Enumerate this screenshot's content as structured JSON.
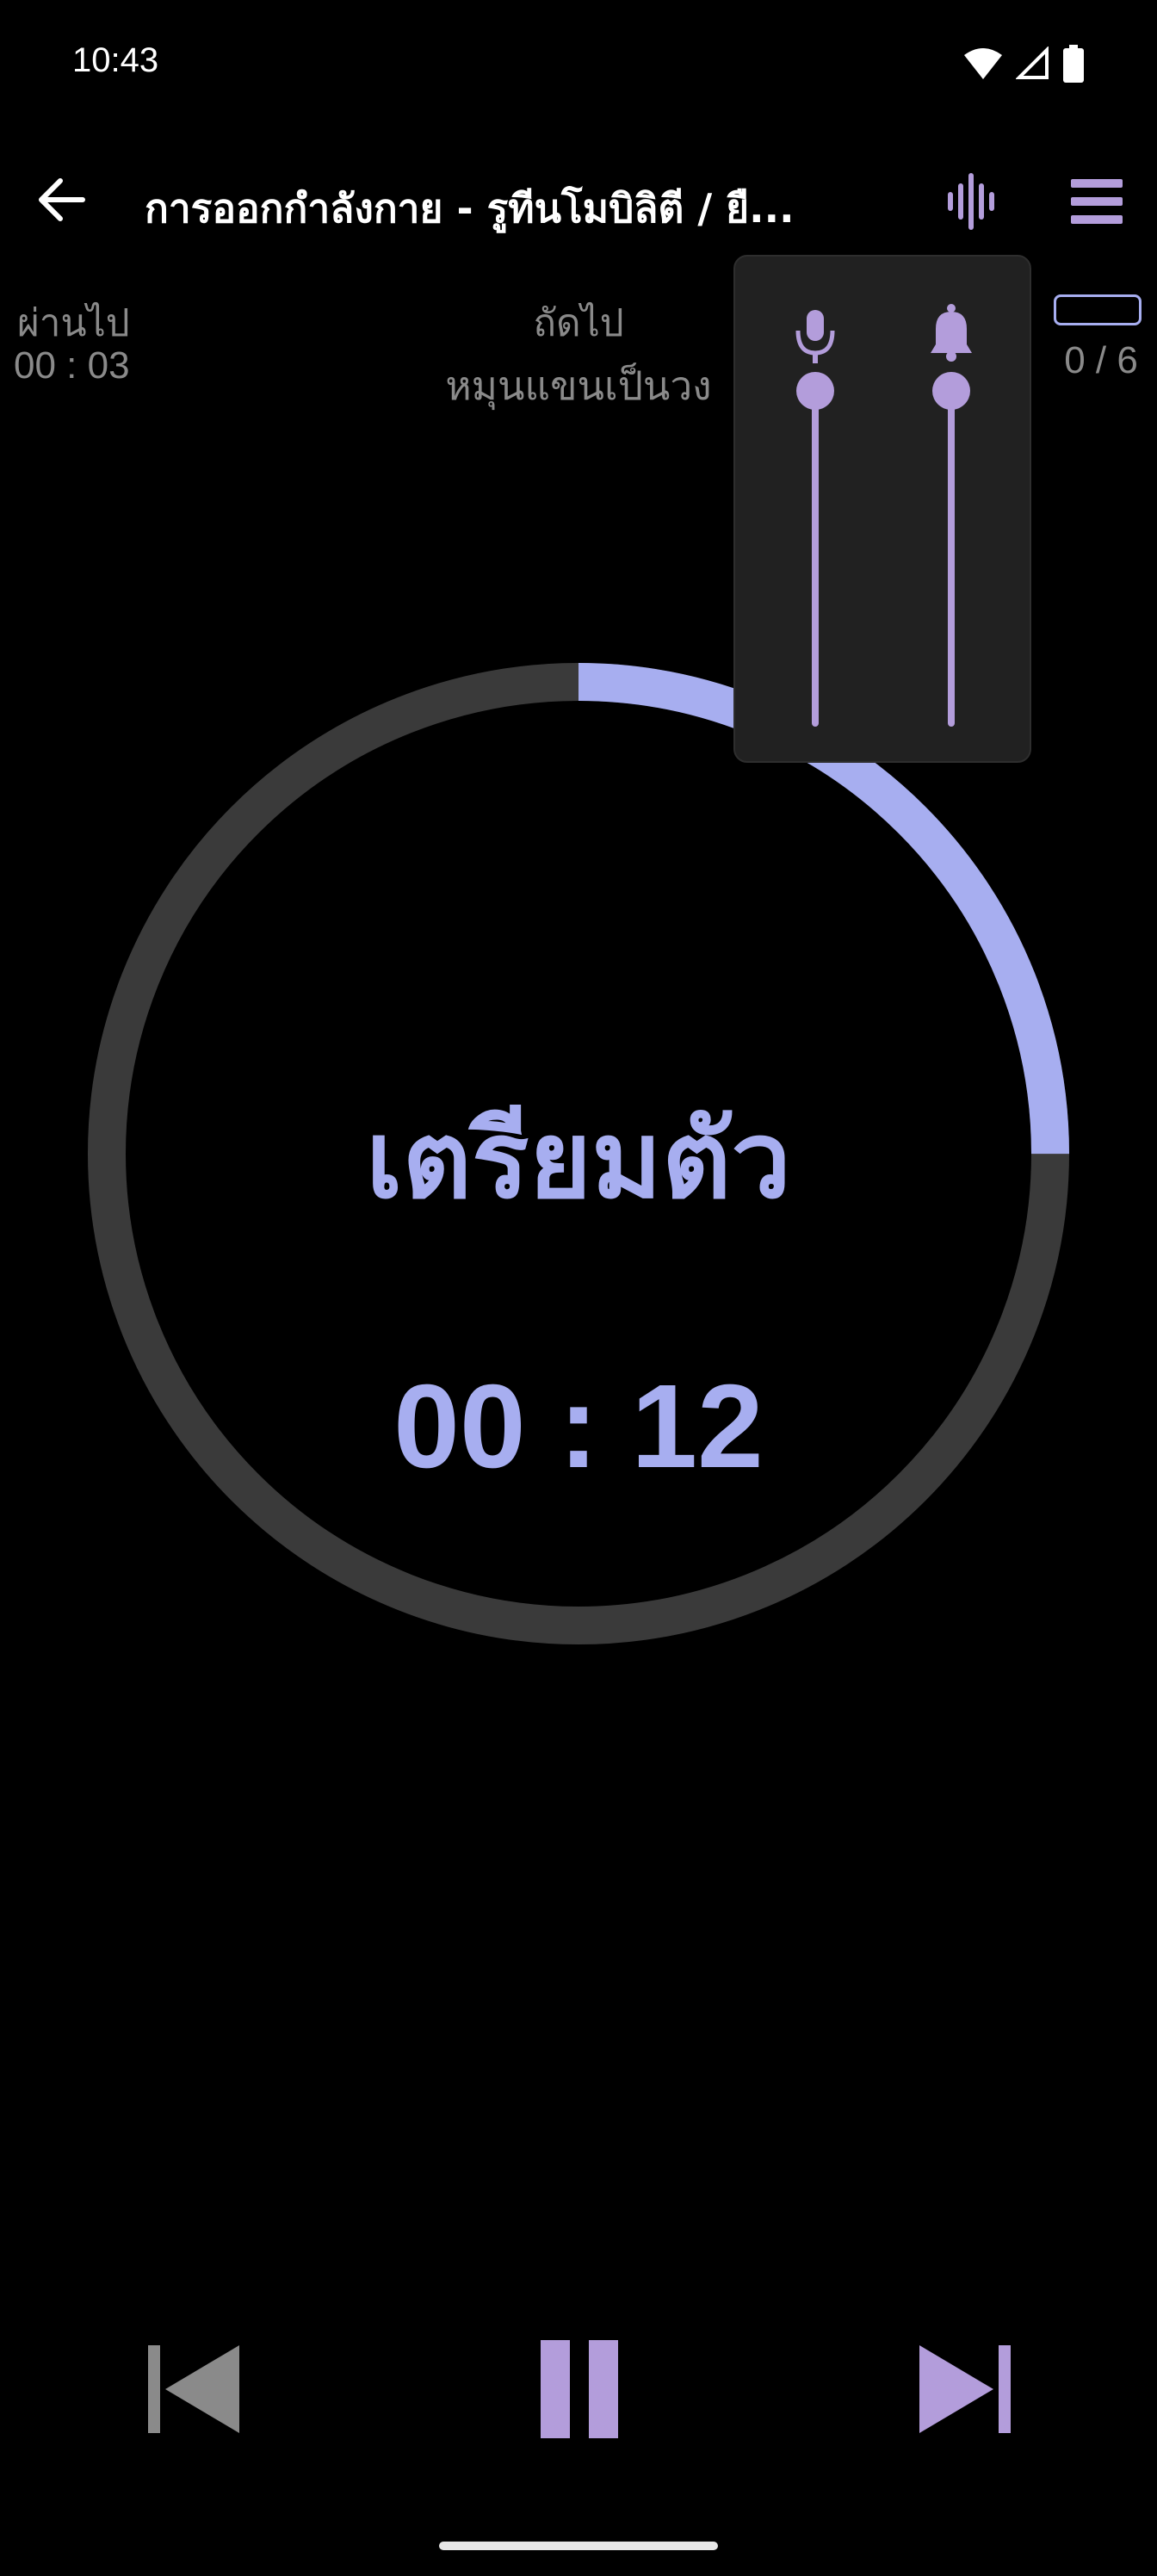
{
  "status_bar": {
    "time": "10:43"
  },
  "app_bar": {
    "title": "การออกกำลังกาย - รูทีนโมบิลิตี / ยื..."
  },
  "info": {
    "elapsed_label": "ผ่านไป",
    "elapsed_value": "00 : 03",
    "next_label": "ถัดไป",
    "next_value": "หมุนแขนเป็นวง",
    "round_value": "0 / 6"
  },
  "timer": {
    "phase_label": "เตรียมตัว",
    "countdown": "00 : 12",
    "progress_fraction": 0.25
  },
  "volume_popup": {
    "voice_level": 1.0,
    "sound_level": 1.0,
    "voice_icon": "mic-icon",
    "sound_icon": "bell-icon"
  },
  "colors": {
    "accent": "#a7aef0",
    "accent_purple": "#b39ddb",
    "ring_track": "#3a3a3a",
    "muted_text": "#8a8a8a",
    "popup_bg": "#212121"
  }
}
